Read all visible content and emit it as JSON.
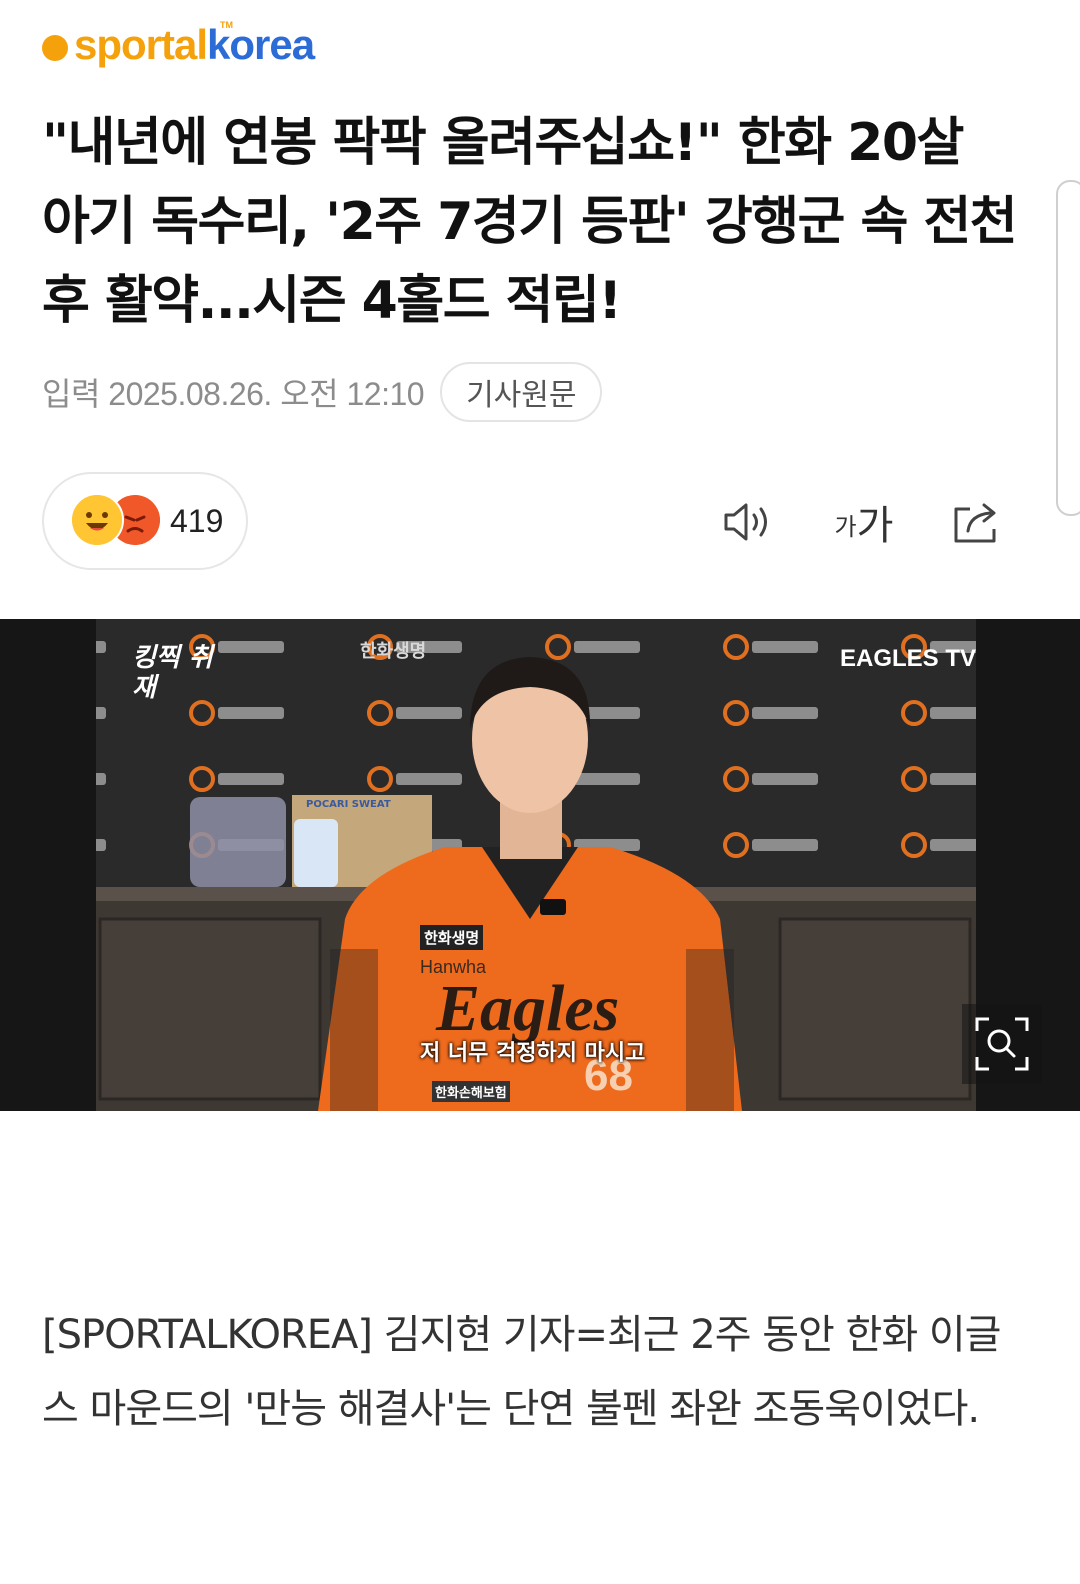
{
  "colors": {
    "brand_orange": "#f5a10c",
    "brand_blue": "#2c6cd6",
    "jersey_orange": "#ee6a1d"
  },
  "header": {
    "logo_sport": "sportal",
    "logo_korea": "korea",
    "logo_tm": "TM"
  },
  "article": {
    "title": "\"내년에 연봉 팍팍 올려주십쇼!\" 한화 20살 아기 독수리, '2주 7경기 등판' 강행군 속 전천후 활약...시즌 4홀드 적립!",
    "date": "입력 2025.08.26. 오전 12:10",
    "source_button": "기사원문",
    "reaction_count": "419",
    "body": "[SPORTALKOREA] 김지현 기자=최근 2주 동안 한화 이글스 마운드의 '만능 해결사'는 단연 불펜 좌완 조동욱이었다."
  },
  "toolbar": {
    "font_small": "가",
    "font_large": "가"
  },
  "toolbar_icons": [
    "speaker-icon",
    "font-size-icon",
    "share-icon"
  ],
  "photo": {
    "sponsor": "한화생명",
    "corner_badge": "킹찍 취재",
    "channel": "EAGLES TV",
    "box_label": "POCARI SWEAT",
    "jersey_brand": "Hanwha",
    "jersey_script": "Eagles",
    "jersey_number": "68",
    "jersey_patch_top": "한화생명",
    "jersey_patch_bottom": "한화손해보험",
    "caption": "저 너무 걱정하지 마시고"
  }
}
